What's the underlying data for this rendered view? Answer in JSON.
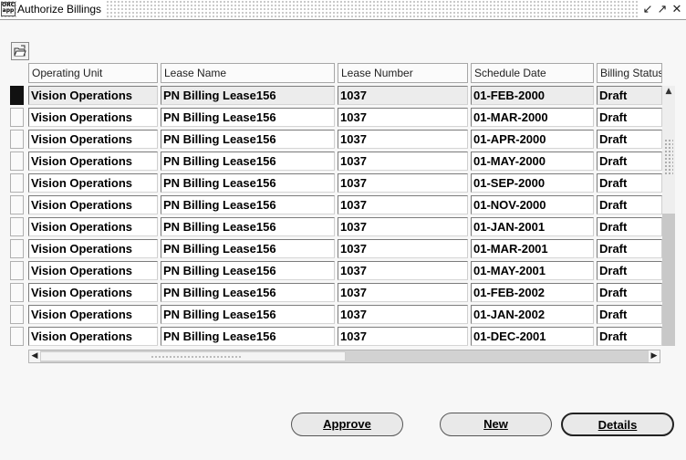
{
  "window": {
    "title": "Authorize Billings",
    "icon": "oracle-app-icon",
    "controls": [
      "minimize-icon",
      "maximize-icon",
      "close-icon"
    ]
  },
  "toolbar": {
    "folder_icon": "folder-open-icon"
  },
  "table": {
    "columns": [
      "Operating Unit",
      "Lease Name",
      "Lease Number",
      "Schedule Date",
      "Billing Status"
    ],
    "rows": [
      [
        "Vision Operations",
        "PN Billing Lease156",
        "1037",
        "01-FEB-2000",
        "Draft"
      ],
      [
        "Vision Operations",
        "PN Billing Lease156",
        "1037",
        "01-MAR-2000",
        "Draft"
      ],
      [
        "Vision Operations",
        "PN Billing Lease156",
        "1037",
        "01-APR-2000",
        "Draft"
      ],
      [
        "Vision Operations",
        "PN Billing Lease156",
        "1037",
        "01-MAY-2000",
        "Draft"
      ],
      [
        "Vision Operations",
        "PN Billing Lease156",
        "1037",
        "01-SEP-2000",
        "Draft"
      ],
      [
        "Vision Operations",
        "PN Billing Lease156",
        "1037",
        "01-NOV-2000",
        "Draft"
      ],
      [
        "Vision Operations",
        "PN Billing Lease156",
        "1037",
        "01-JAN-2001",
        "Draft"
      ],
      [
        "Vision Operations",
        "PN Billing Lease156",
        "1037",
        "01-MAR-2001",
        "Draft"
      ],
      [
        "Vision Operations",
        "PN Billing Lease156",
        "1037",
        "01-MAY-2001",
        "Draft"
      ],
      [
        "Vision Operations",
        "PN Billing Lease156",
        "1037",
        "01-FEB-2002",
        "Draft"
      ],
      [
        "Vision Operations",
        "PN Billing Lease156",
        "1037",
        "01-JAN-2002",
        "Draft"
      ],
      [
        "Vision Operations",
        "PN Billing Lease156",
        "1037",
        "01-DEC-2001",
        "Draft"
      ]
    ]
  },
  "buttons": {
    "approve": "Approve",
    "new": "New",
    "details": "Details"
  }
}
